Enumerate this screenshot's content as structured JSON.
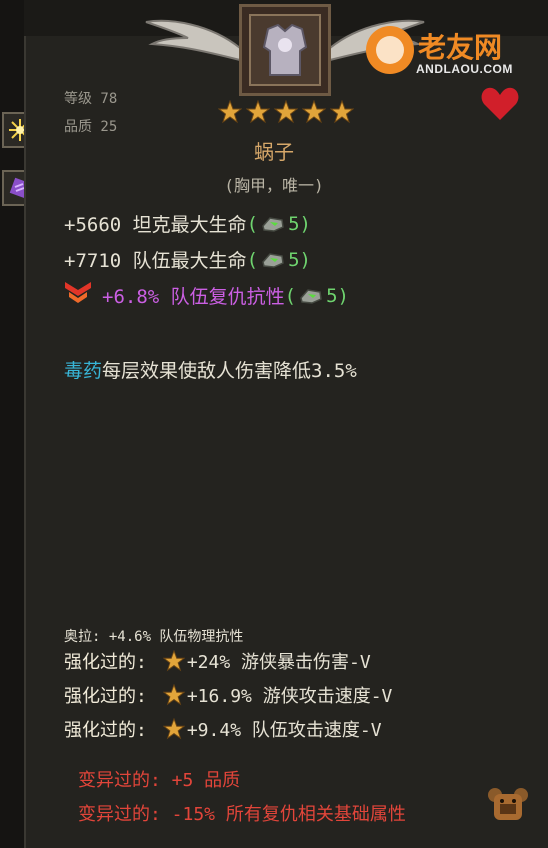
{
  "watermark": {
    "brand": "老友网",
    "domain": "ANDLAOU.COM"
  },
  "item": {
    "level_label": "等级 78",
    "quality_label": "品质 25",
    "stars": 5,
    "name": "蜗子",
    "type": "(胸甲，唯一)"
  },
  "stats": [
    {
      "prefix": "+5660 坦克最大生命",
      "open": "(",
      "gem_count": "5)"
    },
    {
      "prefix": "+7710 队伍最大生命",
      "open": "(",
      "gem_count": "5)"
    },
    {
      "prefix": "+6.8% 队伍复仇抗性",
      "open": "(",
      "gem_count": "5)"
    }
  ],
  "effect": {
    "keyword": "毒药",
    "text": "每层效果使敌人伤害降低3.5%"
  },
  "aura": "奥拉: +4.6% 队伍物理抗性",
  "enhanced": [
    {
      "label": "强化过的:",
      "text": "+24% 游侠暴击伤害-V"
    },
    {
      "label": "强化过的:",
      "text": "+16.9% 游侠攻击速度-V"
    },
    {
      "label": "强化过的:",
      "text": "+9.4% 队伍攻击速度-V"
    }
  ],
  "mutated": [
    "变异过的: +5 品质",
    "变异过的: -15% 所有复仇相关基础属性"
  ],
  "colors": {
    "name": "#d7a86a",
    "stat_green": "#6fd46f",
    "stat_purple": "#cb5fe3",
    "poison_blue": "#38b6d8",
    "mutation_red": "#e2453a"
  },
  "icons": [
    "sun-icon",
    "scroll-icon",
    "wings-icon",
    "armor-icon",
    "heart-icon",
    "star-icon",
    "gem-icon",
    "red-chevron-icon",
    "bear-icon"
  ]
}
